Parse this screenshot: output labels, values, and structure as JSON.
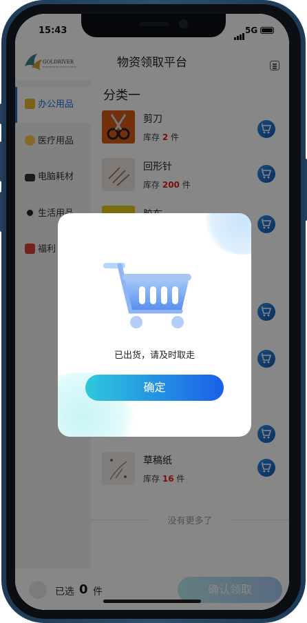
{
  "status": {
    "time": "15:43",
    "network": "5G"
  },
  "header": {
    "title": "物资领取平台",
    "logo_text": "GOLDRIVER",
    "logo_sub": "EXPERIENCE EXCELLENCE"
  },
  "sidebar": {
    "items": [
      {
        "label": "办公用品",
        "icon": "folder-icon",
        "active": true
      },
      {
        "label": "医疗用品",
        "icon": "mask-face-icon"
      },
      {
        "label": "电脑耗材",
        "icon": "laptop-icon"
      },
      {
        "label": "生活用品",
        "icon": "soccer-ball-icon"
      },
      {
        "label": "福利",
        "icon": "gift-icon"
      }
    ]
  },
  "main": {
    "category_title": "分类一",
    "products": [
      {
        "name": "剪刀",
        "stock_label": "库存",
        "stock": "2",
        "unit": "件"
      },
      {
        "name": "回形针",
        "stock_label": "库存",
        "stock": "200",
        "unit": "件"
      },
      {
        "name": "胶布"
      },
      {
        "name": "草稿纸",
        "stock_label": "库存",
        "stock": "16",
        "unit": "件"
      }
    ],
    "no_more": "没有更多了"
  },
  "footer": {
    "selected_label": "已选",
    "count": "0",
    "unit": "件",
    "confirm_label": "确认领取"
  },
  "modal": {
    "message": "已出货，请及时取走",
    "ok_label": "确定"
  },
  "colors": {
    "accent": "#1f6fd6",
    "stock_red": "#e02020",
    "button_start": "#2fc8dc",
    "button_end": "#1a5fe8"
  }
}
